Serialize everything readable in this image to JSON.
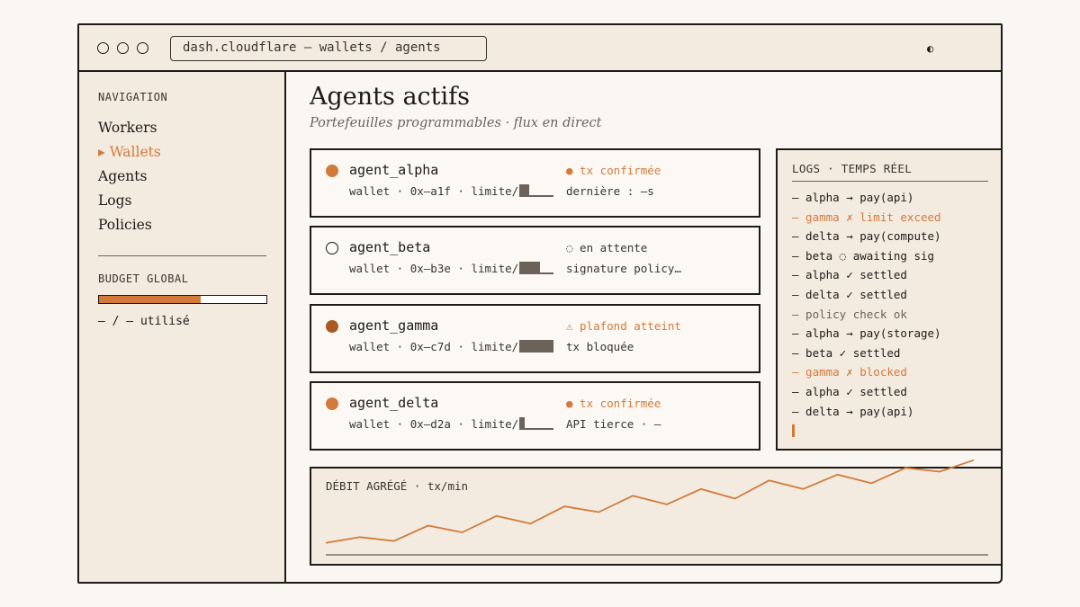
{
  "url": "dash.cloudflare — wallets / agents",
  "theme_icon": "◐",
  "sidebar": {
    "nav_heading": "NAVIGATION",
    "items": [
      {
        "label": "Workers"
      },
      {
        "label": "▸ Wallets"
      },
      {
        "label": "Agents"
      },
      {
        "label": "Logs"
      },
      {
        "label": "Policies"
      }
    ],
    "budget_heading": "BUDGET GLOBAL",
    "budget_fraction": 0.61,
    "budget_text": "— / — utilisé"
  },
  "main": {
    "title": "Agents actifs",
    "subtitle": "Portefeuilles programmables · flux en direct"
  },
  "agents": [
    {
      "name": "agent_alpha",
      "meta": "wallet · 0x—a1f · limite/h",
      "meter": 0.3,
      "status": "● tx confirmée",
      "detail": "dernière : —s",
      "dot": "#d27a3a",
      "dot_style": "filled",
      "status_color": "#d27a3a"
    },
    {
      "name": "agent_beta",
      "meta": "wallet · 0x—b3e · limite/h",
      "meter": 0.6,
      "status": "◌ en attente",
      "detail": "signature policy…",
      "dot": "#1d1a17",
      "dot_style": "hollow",
      "status_color": "#3a342e"
    },
    {
      "name": "agent_gamma",
      "meta": "wallet · 0x—c7d · limite/h",
      "meter": 1.0,
      "status": "⚠ plafond atteint",
      "detail": "tx bloquée",
      "dot": "#a85a22",
      "dot_style": "filled",
      "status_color": "#d27a3a"
    },
    {
      "name": "agent_delta",
      "meta": "wallet · 0x—d2a · limite/h",
      "meter": 0.15,
      "status": "● tx confirmée",
      "detail": "API tierce · —",
      "dot": "#d27a3a",
      "dot_style": "filled",
      "status_color": "#d27a3a"
    }
  ],
  "logs": {
    "title": "LOGS · TEMPS RÉEL",
    "lines": [
      {
        "text": "— alpha → pay(api)",
        "color": "#1d1a17"
      },
      {
        "text": "— gamma ✗ limit exceed",
        "color": "#d27a3a"
      },
      {
        "text": "— delta → pay(compute)",
        "color": "#1d1a17"
      },
      {
        "text": "— beta ◌ awaiting sig",
        "color": "#1d1a17"
      },
      {
        "text": "— alpha ✓ settled",
        "color": "#1d1a17"
      },
      {
        "text": "— delta ✓ settled",
        "color": "#1d1a17"
      },
      {
        "text": "— policy check ok",
        "color": "#6b625a"
      },
      {
        "text": "— alpha → pay(storage)",
        "color": "#1d1a17"
      },
      {
        "text": "— beta ✓ settled",
        "color": "#1d1a17"
      },
      {
        "text": "— gamma ✗ blocked",
        "color": "#d27a3a"
      },
      {
        "text": "— alpha ✓ settled",
        "color": "#1d1a17"
      },
      {
        "text": "— delta → pay(api)",
        "color": "#1d1a17"
      }
    ]
  },
  "chart_data": {
    "type": "line",
    "title": "DÉBIT AGRÉGÉ · tx/min",
    "xlabel": "",
    "ylabel": "",
    "grid": false,
    "x": [
      0,
      1,
      2,
      3,
      4,
      5,
      6,
      7,
      8,
      9,
      10,
      11,
      12,
      13,
      14,
      15,
      16,
      17,
      18,
      19
    ],
    "series": [
      {
        "color": "#d27a3a",
        "values": [
          4,
          10,
          6,
          22,
          15,
          32,
          24,
          42,
          36,
          53,
          44,
          60,
          50,
          69,
          60,
          75,
          66,
          82,
          78,
          90
        ]
      }
    ],
    "ylim": [
      0,
      100
    ]
  }
}
